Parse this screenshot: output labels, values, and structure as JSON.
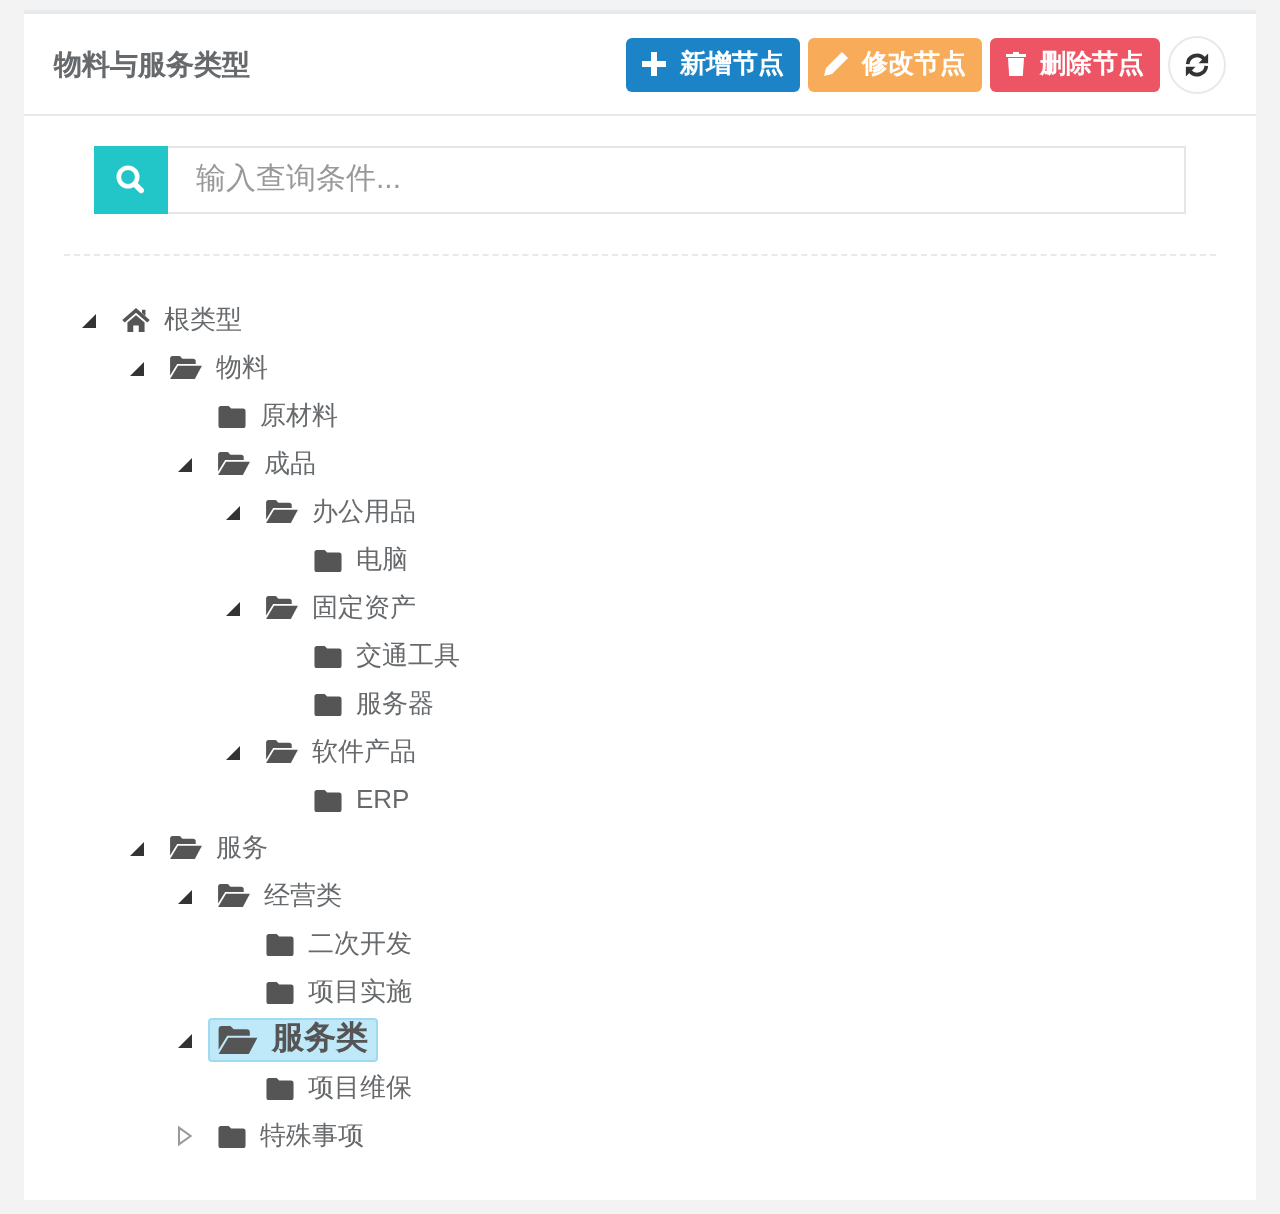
{
  "panel": {
    "title": "物料与服务类型",
    "buttons": [
      {
        "kind": "add",
        "label": "新增节点"
      },
      {
        "kind": "edit",
        "label": "修改节点"
      },
      {
        "kind": "delete",
        "label": "删除节点"
      },
      {
        "kind": "refresh"
      }
    ]
  },
  "search": {
    "placeholder": "输入查询条件..."
  },
  "tree": [
    {
      "label": "根类型",
      "kind": "root",
      "expanded": true,
      "selected": false,
      "children": [
        {
          "label": "物料",
          "kind": "branch",
          "expanded": true,
          "selected": false,
          "children": [
            {
              "label": "原材料",
              "kind": "leaf",
              "selected": false
            },
            {
              "label": "成品",
              "kind": "branch",
              "expanded": true,
              "selected": false,
              "children": [
                {
                  "label": "办公用品",
                  "kind": "branch",
                  "expanded": true,
                  "selected": false,
                  "children": [
                    {
                      "label": "电脑",
                      "kind": "leaf",
                      "selected": false
                    }
                  ]
                },
                {
                  "label": "固定资产",
                  "kind": "branch",
                  "expanded": true,
                  "selected": false,
                  "children": [
                    {
                      "label": "交通工具",
                      "kind": "leaf",
                      "selected": false
                    },
                    {
                      "label": "服务器",
                      "kind": "leaf",
                      "selected": false
                    }
                  ]
                },
                {
                  "label": "软件产品",
                  "kind": "branch",
                  "expanded": true,
                  "selected": false,
                  "children": [
                    {
                      "label": "ERP",
                      "kind": "leaf",
                      "selected": false
                    }
                  ]
                }
              ]
            }
          ]
        },
        {
          "label": "服务",
          "kind": "branch",
          "expanded": true,
          "selected": false,
          "children": [
            {
              "label": "经营类",
              "kind": "branch",
              "expanded": true,
              "selected": false,
              "children": [
                {
                  "label": "二次开发",
                  "kind": "leaf",
                  "selected": false
                },
                {
                  "label": "项目实施",
                  "kind": "leaf",
                  "selected": false
                }
              ]
            },
            {
              "label": "服务类",
              "kind": "branch",
              "expanded": true,
              "selected": true,
              "children": [
                {
                  "label": "项目维保",
                  "kind": "leaf",
                  "selected": false
                }
              ]
            },
            {
              "label": "特殊事项",
              "kind": "branch",
              "expanded": false,
              "selected": false
            }
          ]
        }
      ]
    }
  ]
}
